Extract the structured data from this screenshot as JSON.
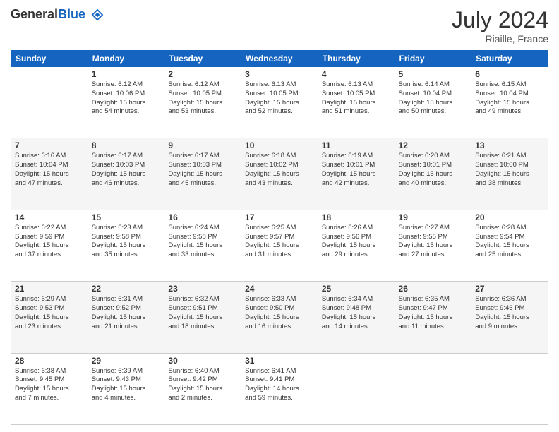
{
  "header": {
    "logo_general": "General",
    "logo_blue": "Blue",
    "month_year": "July 2024",
    "location": "Riaille, France"
  },
  "columns": [
    "Sunday",
    "Monday",
    "Tuesday",
    "Wednesday",
    "Thursday",
    "Friday",
    "Saturday"
  ],
  "weeks": [
    [
      {
        "day": "",
        "info": ""
      },
      {
        "day": "1",
        "info": "Sunrise: 6:12 AM\nSunset: 10:06 PM\nDaylight: 15 hours\nand 54 minutes."
      },
      {
        "day": "2",
        "info": "Sunrise: 6:12 AM\nSunset: 10:05 PM\nDaylight: 15 hours\nand 53 minutes."
      },
      {
        "day": "3",
        "info": "Sunrise: 6:13 AM\nSunset: 10:05 PM\nDaylight: 15 hours\nand 52 minutes."
      },
      {
        "day": "4",
        "info": "Sunrise: 6:13 AM\nSunset: 10:05 PM\nDaylight: 15 hours\nand 51 minutes."
      },
      {
        "day": "5",
        "info": "Sunrise: 6:14 AM\nSunset: 10:04 PM\nDaylight: 15 hours\nand 50 minutes."
      },
      {
        "day": "6",
        "info": "Sunrise: 6:15 AM\nSunset: 10:04 PM\nDaylight: 15 hours\nand 49 minutes."
      }
    ],
    [
      {
        "day": "7",
        "info": "Sunrise: 6:16 AM\nSunset: 10:04 PM\nDaylight: 15 hours\nand 47 minutes."
      },
      {
        "day": "8",
        "info": "Sunrise: 6:17 AM\nSunset: 10:03 PM\nDaylight: 15 hours\nand 46 minutes."
      },
      {
        "day": "9",
        "info": "Sunrise: 6:17 AM\nSunset: 10:03 PM\nDaylight: 15 hours\nand 45 minutes."
      },
      {
        "day": "10",
        "info": "Sunrise: 6:18 AM\nSunset: 10:02 PM\nDaylight: 15 hours\nand 43 minutes."
      },
      {
        "day": "11",
        "info": "Sunrise: 6:19 AM\nSunset: 10:01 PM\nDaylight: 15 hours\nand 42 minutes."
      },
      {
        "day": "12",
        "info": "Sunrise: 6:20 AM\nSunset: 10:01 PM\nDaylight: 15 hours\nand 40 minutes."
      },
      {
        "day": "13",
        "info": "Sunrise: 6:21 AM\nSunset: 10:00 PM\nDaylight: 15 hours\nand 38 minutes."
      }
    ],
    [
      {
        "day": "14",
        "info": "Sunrise: 6:22 AM\nSunset: 9:59 PM\nDaylight: 15 hours\nand 37 minutes."
      },
      {
        "day": "15",
        "info": "Sunrise: 6:23 AM\nSunset: 9:58 PM\nDaylight: 15 hours\nand 35 minutes."
      },
      {
        "day": "16",
        "info": "Sunrise: 6:24 AM\nSunset: 9:58 PM\nDaylight: 15 hours\nand 33 minutes."
      },
      {
        "day": "17",
        "info": "Sunrise: 6:25 AM\nSunset: 9:57 PM\nDaylight: 15 hours\nand 31 minutes."
      },
      {
        "day": "18",
        "info": "Sunrise: 6:26 AM\nSunset: 9:56 PM\nDaylight: 15 hours\nand 29 minutes."
      },
      {
        "day": "19",
        "info": "Sunrise: 6:27 AM\nSunset: 9:55 PM\nDaylight: 15 hours\nand 27 minutes."
      },
      {
        "day": "20",
        "info": "Sunrise: 6:28 AM\nSunset: 9:54 PM\nDaylight: 15 hours\nand 25 minutes."
      }
    ],
    [
      {
        "day": "21",
        "info": "Sunrise: 6:29 AM\nSunset: 9:53 PM\nDaylight: 15 hours\nand 23 minutes."
      },
      {
        "day": "22",
        "info": "Sunrise: 6:31 AM\nSunset: 9:52 PM\nDaylight: 15 hours\nand 21 minutes."
      },
      {
        "day": "23",
        "info": "Sunrise: 6:32 AM\nSunset: 9:51 PM\nDaylight: 15 hours\nand 18 minutes."
      },
      {
        "day": "24",
        "info": "Sunrise: 6:33 AM\nSunset: 9:50 PM\nDaylight: 15 hours\nand 16 minutes."
      },
      {
        "day": "25",
        "info": "Sunrise: 6:34 AM\nSunset: 9:48 PM\nDaylight: 15 hours\nand 14 minutes."
      },
      {
        "day": "26",
        "info": "Sunrise: 6:35 AM\nSunset: 9:47 PM\nDaylight: 15 hours\nand 11 minutes."
      },
      {
        "day": "27",
        "info": "Sunrise: 6:36 AM\nSunset: 9:46 PM\nDaylight: 15 hours\nand 9 minutes."
      }
    ],
    [
      {
        "day": "28",
        "info": "Sunrise: 6:38 AM\nSunset: 9:45 PM\nDaylight: 15 hours\nand 7 minutes."
      },
      {
        "day": "29",
        "info": "Sunrise: 6:39 AM\nSunset: 9:43 PM\nDaylight: 15 hours\nand 4 minutes."
      },
      {
        "day": "30",
        "info": "Sunrise: 6:40 AM\nSunset: 9:42 PM\nDaylight: 15 hours\nand 2 minutes."
      },
      {
        "day": "31",
        "info": "Sunrise: 6:41 AM\nSunset: 9:41 PM\nDaylight: 14 hours\nand 59 minutes."
      },
      {
        "day": "",
        "info": ""
      },
      {
        "day": "",
        "info": ""
      },
      {
        "day": "",
        "info": ""
      }
    ]
  ]
}
